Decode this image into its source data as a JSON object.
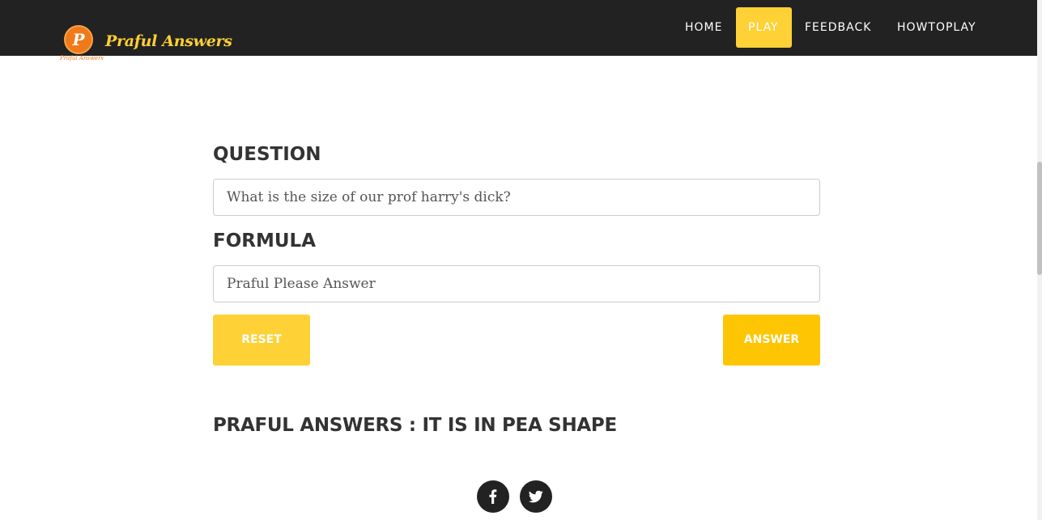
{
  "brand": {
    "logo_letter": "P",
    "name": "Praful Answers",
    "logo_subtitle": "Praful Answers"
  },
  "nav": {
    "items": [
      {
        "label": "HOME"
      },
      {
        "label": "PLAY"
      },
      {
        "label": "FEEDBACK"
      },
      {
        "label": "HOWTOPLAY"
      }
    ],
    "active": "PLAY"
  },
  "form": {
    "question_label": "QUESTION",
    "question_value": "What is the size of our prof harry's dick?",
    "formula_label": "FORMULA",
    "formula_value": "Praful Please Answer",
    "reset_label": "RESET",
    "answer_label": "ANSWER"
  },
  "result": {
    "heading": "PRAFUL ANSWERS : IT IS IN PEA SHAPE"
  },
  "social": {
    "items": [
      "facebook-icon",
      "twitter-icon"
    ]
  },
  "colors": {
    "accent": "#fed136",
    "accent_dark": "#fec503",
    "navbar": "#222222",
    "logo": "#f07a1a"
  }
}
